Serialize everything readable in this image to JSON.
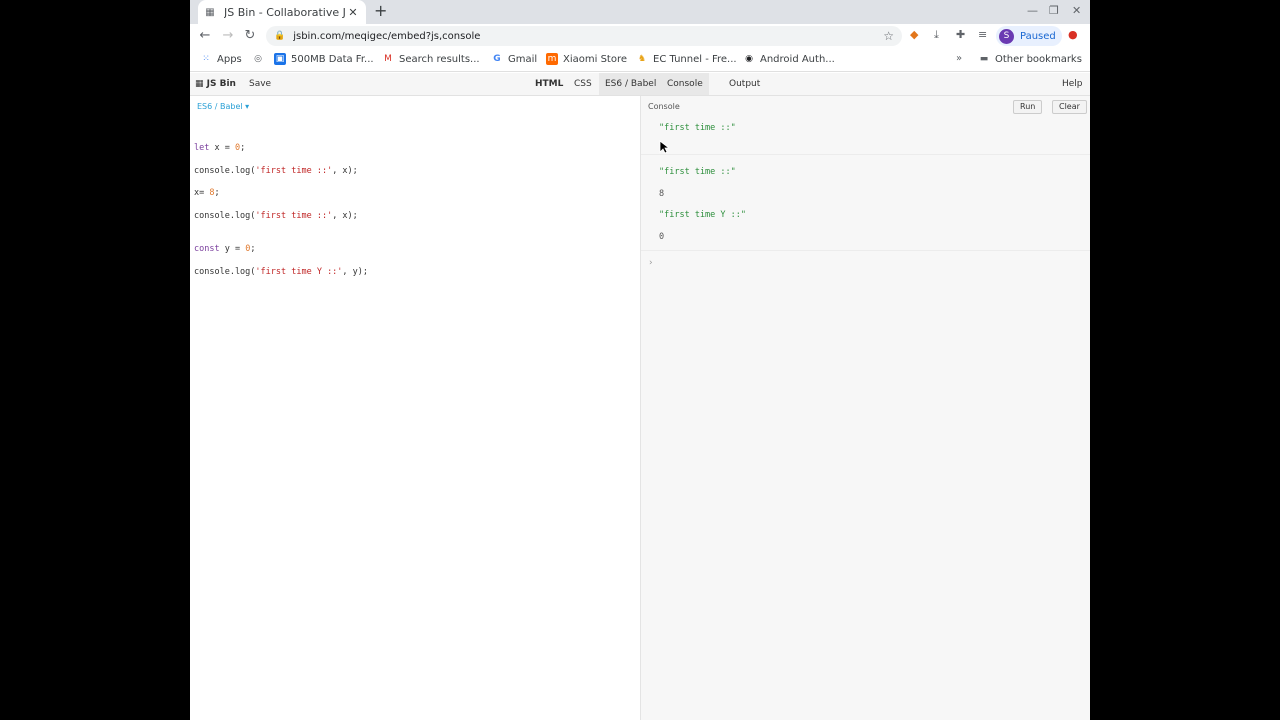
{
  "browser": {
    "tab_title": "JS Bin - Collaborative Jav",
    "url": "jsbin.com/meqigec/embed?js,console",
    "profile_initial": "S",
    "profile_status": "Paused",
    "bookmarks": [
      {
        "label": "Apps",
        "icon": "apps-grid-icon"
      },
      {
        "label": "",
        "icon": "globe-icon"
      },
      {
        "label": "500MB Data Fr...",
        "icon": "data-icon"
      },
      {
        "label": "Search results...",
        "icon": "gmail-icon"
      },
      {
        "label": "Gmail",
        "icon": "google-icon"
      },
      {
        "label": "Xiaomi Store",
        "icon": "mi-icon"
      },
      {
        "label": "EC Tunnel - Fre...",
        "icon": "tunnel-icon"
      },
      {
        "label": "Android Auth...",
        "icon": "android-icon"
      }
    ],
    "other_bookmarks": "Other bookmarks"
  },
  "jsbin": {
    "logo": "JS Bin",
    "save": "Save",
    "help": "Help",
    "tabs": [
      "HTML",
      "CSS",
      "ES6 / Babel",
      "Console",
      "Output"
    ],
    "language": "ES6 / Babel ▾",
    "code": [
      "let x = 0;",
      "console.log('first time ::', x);",
      "x= 8;",
      "console.log('first time ::', x);",
      "const y = 0;",
      "console.log('first time Y ::', y);"
    ]
  },
  "console": {
    "label": "Console",
    "run": "Run",
    "clear": "Clear",
    "entries": [
      {
        "text": "\"first time ::\"",
        "value": ""
      },
      {
        "text": "\"first time ::\"",
        "value": "8"
      },
      {
        "text": "\"first time Y ::\"",
        "value": "0"
      }
    ],
    "prompt": "›"
  },
  "colors": {
    "accent": "#2aa0d6",
    "string": "#2d8f3c",
    "paused_bg": "#e8f0fe"
  }
}
